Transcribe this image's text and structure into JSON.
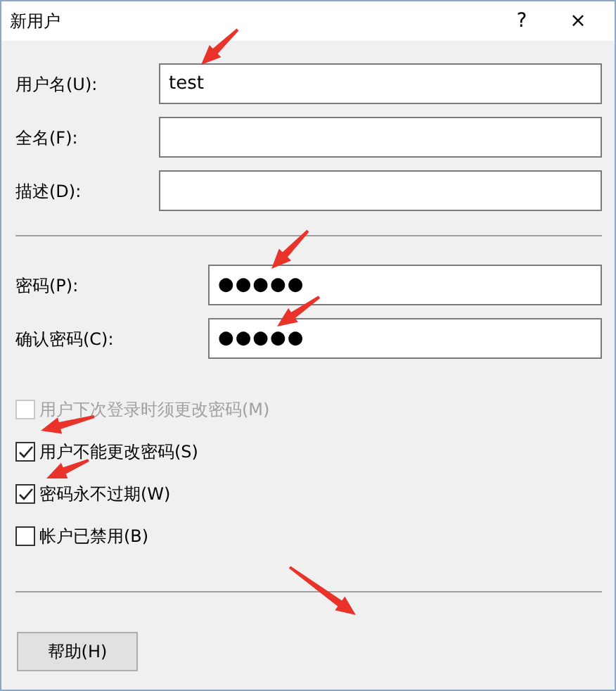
{
  "window": {
    "title": "新用户",
    "help": "?",
    "close": "×"
  },
  "fields": [
    {
      "label": "用户名(U):",
      "value": "test"
    },
    {
      "label": "全名(F):"
    },
    {
      "label": "描述(D):"
    }
  ],
  "password_fields": [
    {
      "label": "密码(P):",
      "value": "●●●●●"
    },
    {
      "label": "确认密码(C):",
      "value": "●●●●●"
    }
  ],
  "options": [
    {
      "label": "用户下次登录时须更改密码(M)",
      "checked": false,
      "disabled": true
    },
    {
      "label": "用户不能更改密码(S)",
      "checked": true,
      "disabled": false
    },
    {
      "label": "密码永不过期(W)",
      "checked": true,
      "disabled": false
    },
    {
      "label": "帐户已禁用(B)",
      "checked": false,
      "disabled": false
    }
  ],
  "buttons": [
    "帮助(H)"
  ]
}
